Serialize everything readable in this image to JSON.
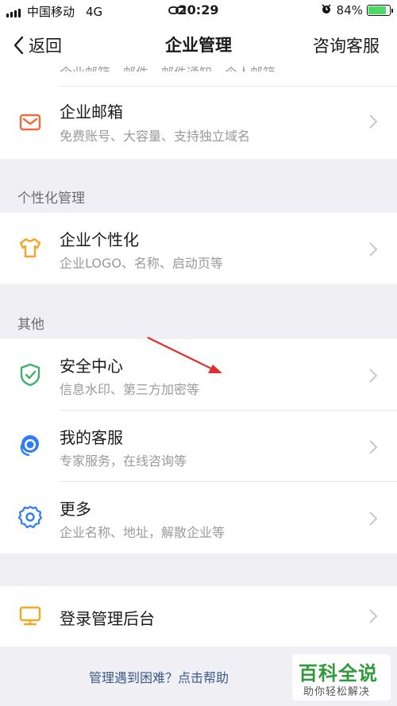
{
  "status_bar": {
    "carrier": "中国移动",
    "network": "4G",
    "time": "20:29",
    "battery": "84%",
    "battery_level": 0.84
  },
  "nav": {
    "back_label": "返回",
    "title": "企业管理",
    "right_label": "咨询客服"
  },
  "top_partial_row": {
    "text": "企业邮箱、邮件、邮件通知、个人邮箱"
  },
  "email_row": {
    "title": "企业邮箱",
    "subtitle": "免费账号、大容量、支持独立域名"
  },
  "section_personalize": {
    "label": "个性化管理"
  },
  "personalize_row": {
    "title": "企业个性化",
    "subtitle": "企业LOGO、名称、启动页等"
  },
  "section_other": {
    "label": "其他"
  },
  "other_rows": [
    {
      "title": "安全中心",
      "subtitle": "信息水印、第三方加密等"
    },
    {
      "title": "我的客服",
      "subtitle": "专家服务，在线咨询等"
    },
    {
      "title": "更多",
      "subtitle": "企业名称、地址，解散企业等"
    }
  ],
  "admin_row": {
    "title": "登录管理后台"
  },
  "help_link": "管理遇到困难？点击帮助",
  "watermark": {
    "line1": "百科全说",
    "line2": "助你轻松解决"
  },
  "colors": {
    "email_icon": "#f06a3c",
    "personalize_icon": "#f5a623",
    "security_icon": "#3bb26a",
    "service_icon": "#2f7cf6",
    "more_icon": "#2f7cf6",
    "admin_icon": "#f5a623",
    "annotation_arrow": "#e0302c"
  }
}
